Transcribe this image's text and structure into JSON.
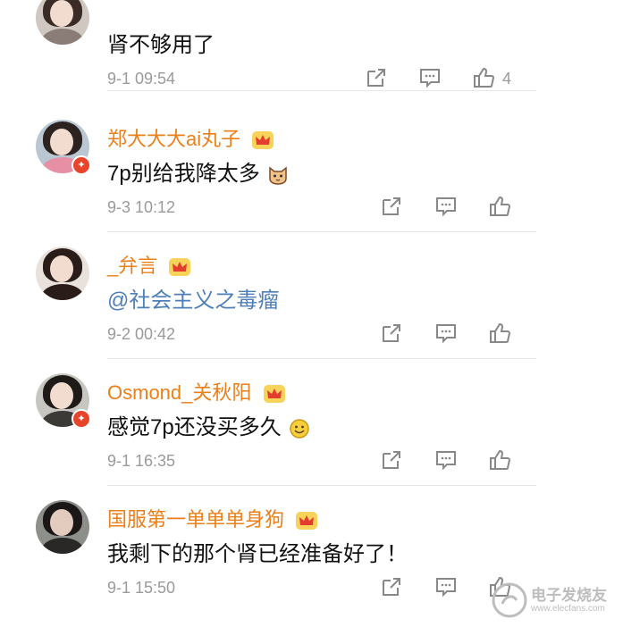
{
  "comments": [
    {
      "name": "",
      "text": "肾不够用了",
      "time": "9-1 09:54",
      "likes": "4"
    },
    {
      "name": "郑大大大ai丸子",
      "text": "7p别给我降太多",
      "time": "9-3 10:12",
      "likes": ""
    },
    {
      "name": "_弁言",
      "text": "@社会主义之毒瘤",
      "time": "9-2 00:42",
      "likes": ""
    },
    {
      "name": "Osmond_关秋阳",
      "text": "感觉7p还没买多久",
      "time": "9-1 16:35",
      "likes": ""
    },
    {
      "name": "国服第一单单单身狗",
      "text": "我剩下的那个肾已经准备好了！",
      "time": "9-1 15:50",
      "likes": ""
    }
  ],
  "icons": {
    "share": "share-icon",
    "comment": "comment-icon",
    "like": "thumbs-up-icon",
    "crown": "crown-icon",
    "emoji_cat": "cat-emoji-icon",
    "emoji_smile": "smile-emoji-icon"
  },
  "colors": {
    "username": "#eb7f18",
    "mention": "#4f7fb8",
    "meta": "#9a9a9a"
  },
  "watermark": {
    "line1": "电子发烧友",
    "line2": "www.elecfans.com"
  }
}
